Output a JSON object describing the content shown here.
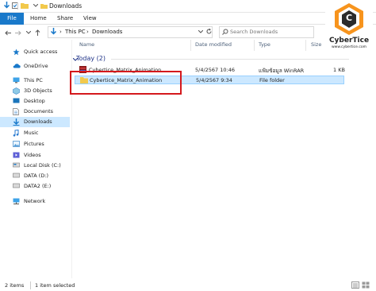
{
  "window": {
    "title": "Downloads"
  },
  "ribbon": {
    "tabs": [
      "File",
      "Home",
      "Share",
      "View"
    ]
  },
  "address": {
    "breadcrumb": [
      "This PC",
      "Downloads"
    ]
  },
  "search": {
    "placeholder": "Search Downloads"
  },
  "sidebar": {
    "items": [
      {
        "label": "Quick access",
        "icon": "star-icon"
      },
      {
        "label": "OneDrive",
        "icon": "cloud-icon"
      },
      {
        "label": "This PC",
        "icon": "computer-icon"
      },
      {
        "label": "3D Objects",
        "icon": "cube-icon"
      },
      {
        "label": "Desktop",
        "icon": "desktop-icon"
      },
      {
        "label": "Documents",
        "icon": "document-icon"
      },
      {
        "label": "Downloads",
        "icon": "download-icon"
      },
      {
        "label": "Music",
        "icon": "music-icon"
      },
      {
        "label": "Pictures",
        "icon": "picture-icon"
      },
      {
        "label": "Videos",
        "icon": "video-icon"
      },
      {
        "label": "Local Disk (C:)",
        "icon": "drive-icon"
      },
      {
        "label": "DATA (D:)",
        "icon": "drive-icon"
      },
      {
        "label": "DATA2 (E:)",
        "icon": "drive-icon"
      },
      {
        "label": "Network",
        "icon": "network-icon"
      }
    ],
    "selected": "Downloads"
  },
  "columns": {
    "name": "Name",
    "date": "Date modified",
    "type": "Type",
    "size": "Size"
  },
  "group": {
    "label": "Today (2)"
  },
  "files": [
    {
      "name": "Cybertice_Matrix_Animation",
      "date": "5/4/2567 10:46",
      "type": "แฟ้มข้อมูล WinRAR",
      "size": "1 KB"
    },
    {
      "name": "Cybertice_Matrix_Animation",
      "date": "5/4/2567 9:34",
      "type": "File folder",
      "size": ""
    }
  ],
  "status": {
    "items": "2 items",
    "selected": "1 item selected"
  },
  "logo": {
    "text": "CyberTice",
    "url": "www.cybertice.com",
    "letter": "C"
  },
  "colors": {
    "accent": "#1979ca",
    "selection": "#cce8ff",
    "highlight": "#d4191d",
    "logo_orange": "#f7941d"
  }
}
